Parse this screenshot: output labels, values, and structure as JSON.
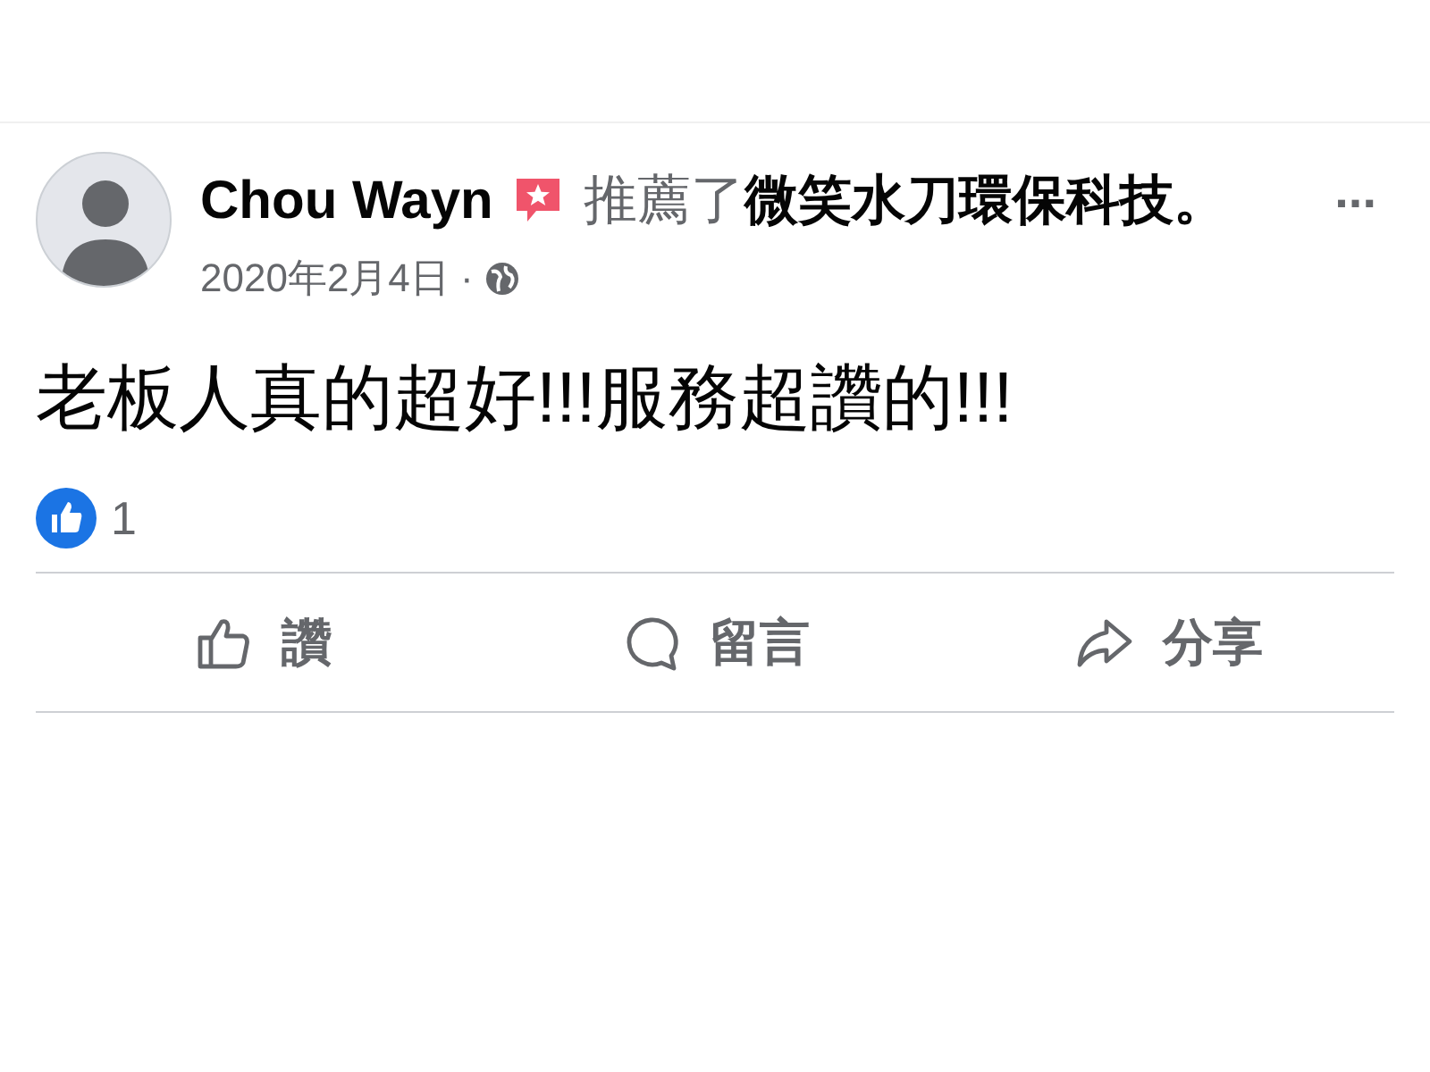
{
  "post": {
    "author": "Chou Wayn",
    "verb": "推薦了",
    "page": "微笑水刀環保科技。",
    "more": "...",
    "date": "2020年2月4日 ·",
    "body": "老板人真的超好!!!服務超讚的!!!"
  },
  "reactions": {
    "count": "1"
  },
  "actions": [
    {
      "kind": "like",
      "label": "讚"
    },
    {
      "kind": "comment",
      "label": "留言"
    },
    {
      "kind": "share",
      "label": "分享"
    }
  ]
}
